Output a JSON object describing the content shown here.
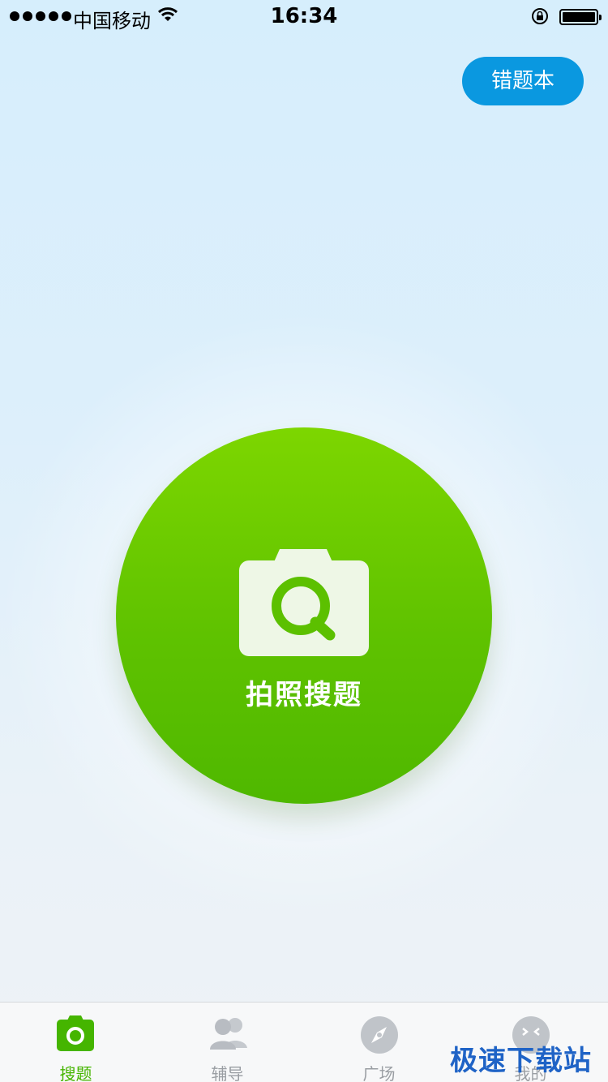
{
  "status_bar": {
    "carrier": "中国移动",
    "time": "16:34"
  },
  "header": {
    "mistakes_button": "错题本"
  },
  "main": {
    "camera_label": "拍照搜题"
  },
  "tabs": [
    {
      "label": "搜题",
      "icon": "camera-icon",
      "active": true
    },
    {
      "label": "辅导",
      "icon": "people-icon",
      "active": false
    },
    {
      "label": "广场",
      "icon": "compass-icon",
      "active": false
    },
    {
      "label": "我的",
      "icon": "face-icon",
      "active": false
    }
  ],
  "watermark": "极速下载站",
  "colors": {
    "accent_green": "#5fc200",
    "button_blue": "#0a98e0",
    "tab_active": "#45b500",
    "tab_inactive": "#9a9ea3"
  }
}
